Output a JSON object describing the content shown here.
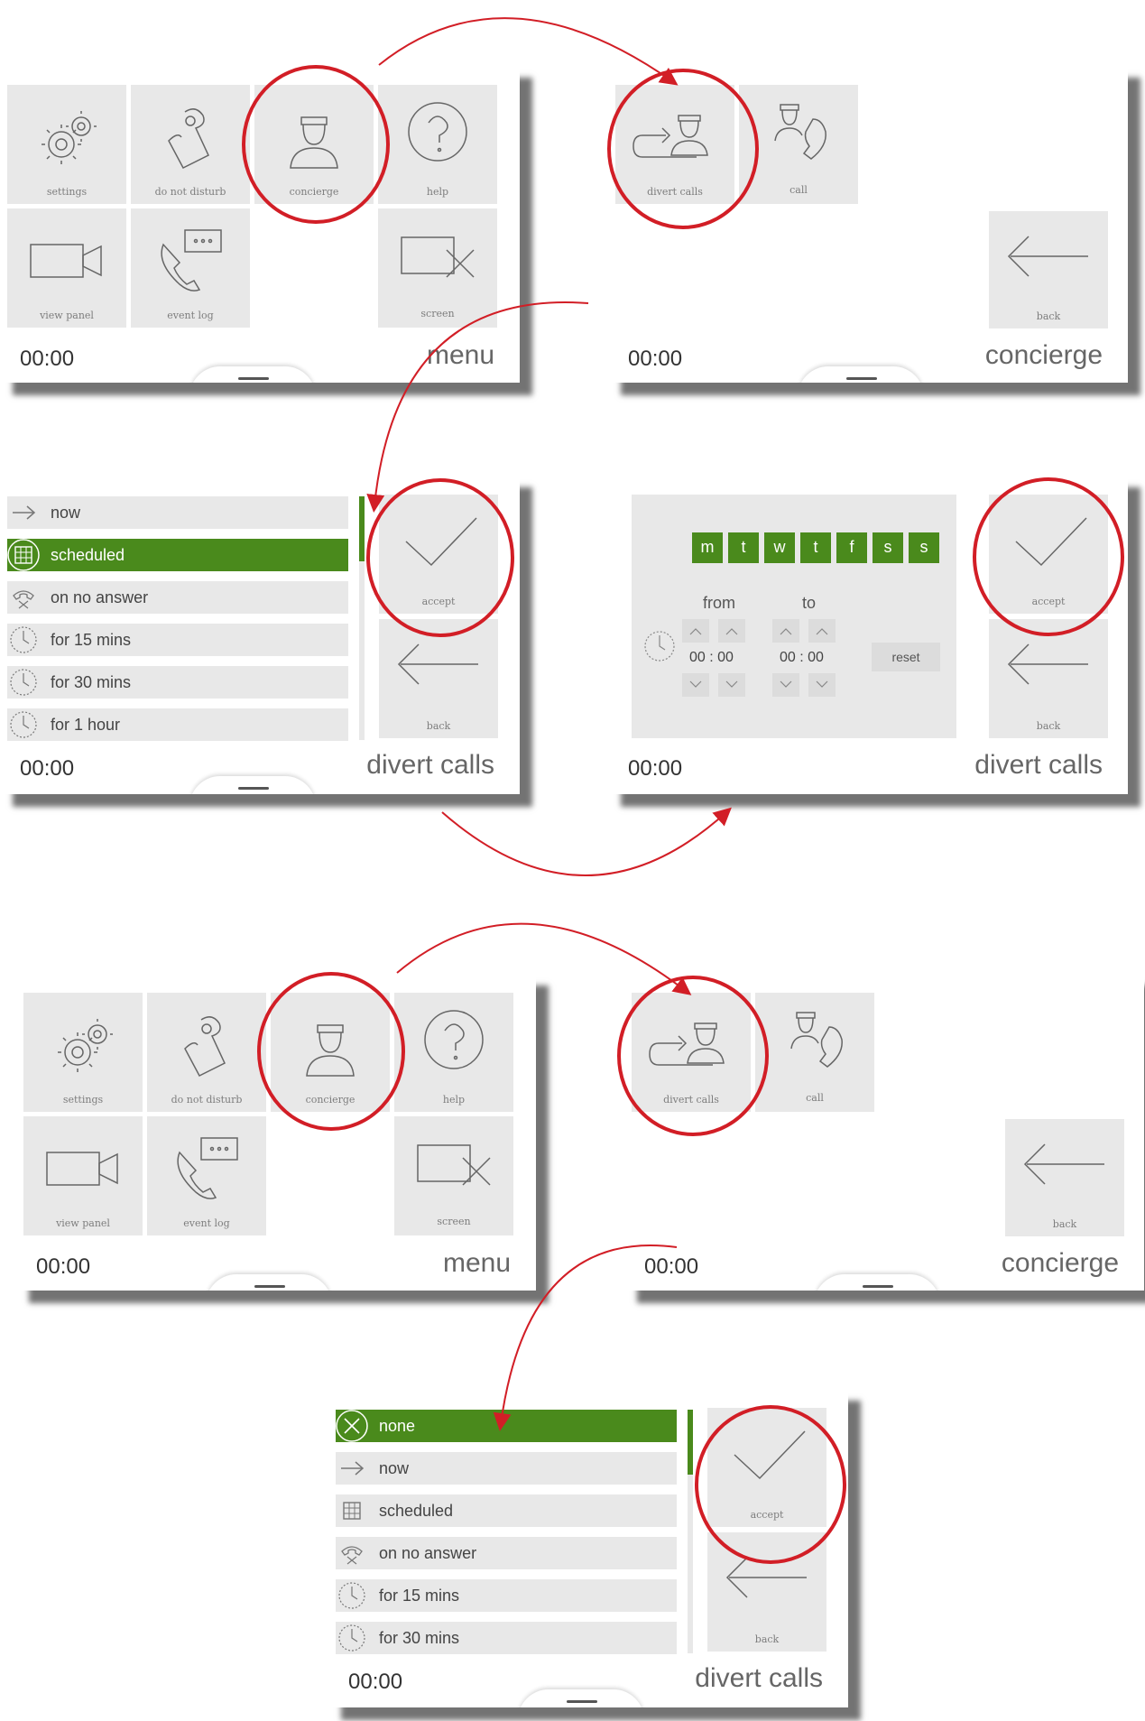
{
  "colors": {
    "accent_green": "#4a8a1c",
    "annotation_red": "#d21e26",
    "tile_gray": "#e8e8e8"
  },
  "menu": {
    "time": "00:00",
    "title": "menu",
    "tiles": {
      "settings": "settings",
      "dnd": "do not disturb",
      "concierge": "concierge",
      "help": "help",
      "view_panel": "view panel",
      "event_log": "event log",
      "screen": "screen"
    }
  },
  "concierge": {
    "time": "00:00",
    "title": "concierge",
    "tiles": {
      "divert": "divert calls",
      "call": "call",
      "back": "back"
    }
  },
  "divert_list_1": {
    "time": "00:00",
    "title": "divert calls",
    "items": [
      {
        "label": "now",
        "icon": "arrow-right-icon",
        "selected": false
      },
      {
        "label": "scheduled",
        "icon": "calendar-icon",
        "selected": true
      },
      {
        "label": "on no answer",
        "icon": "phone-hangup-icon",
        "selected": false
      },
      {
        "label": "for 15 mins",
        "icon": "clock-icon",
        "selected": false
      },
      {
        "label": "for 30 mins",
        "icon": "clock-icon",
        "selected": false
      },
      {
        "label": "for 1 hour",
        "icon": "clock-icon",
        "selected": false
      }
    ],
    "accept": "accept",
    "back": "back"
  },
  "schedule": {
    "time": "00:00",
    "title": "divert calls",
    "days": [
      "m",
      "t",
      "w",
      "t",
      "f",
      "s",
      "s"
    ],
    "from_label": "from",
    "to_label": "to",
    "from_time": "00 : 00",
    "to_time": "00 : 00",
    "reset": "reset",
    "accept": "accept",
    "back": "back"
  },
  "menu_2": {
    "time": "00:00",
    "title": "menu",
    "tiles": {
      "settings": "settings",
      "dnd": "do not disturb",
      "concierge": "concierge",
      "help": "help",
      "view_panel": "view panel",
      "event_log": "event log",
      "screen": "screen"
    }
  },
  "concierge_2": {
    "time": "00:00",
    "title": "concierge",
    "tiles": {
      "divert": "divert calls",
      "call": "call",
      "back": "back"
    }
  },
  "divert_list_2": {
    "time": "00:00",
    "title": "divert calls",
    "items": [
      {
        "label": "none",
        "icon": "cancel-icon",
        "selected": true
      },
      {
        "label": "now",
        "icon": "arrow-right-icon",
        "selected": false
      },
      {
        "label": "scheduled",
        "icon": "calendar-icon",
        "selected": false
      },
      {
        "label": "on no answer",
        "icon": "phone-hangup-icon",
        "selected": false
      },
      {
        "label": "for 15 mins",
        "icon": "clock-icon",
        "selected": false
      },
      {
        "label": "for 30 mins",
        "icon": "clock-icon",
        "selected": false
      }
    ],
    "accept": "accept",
    "back": "back"
  }
}
